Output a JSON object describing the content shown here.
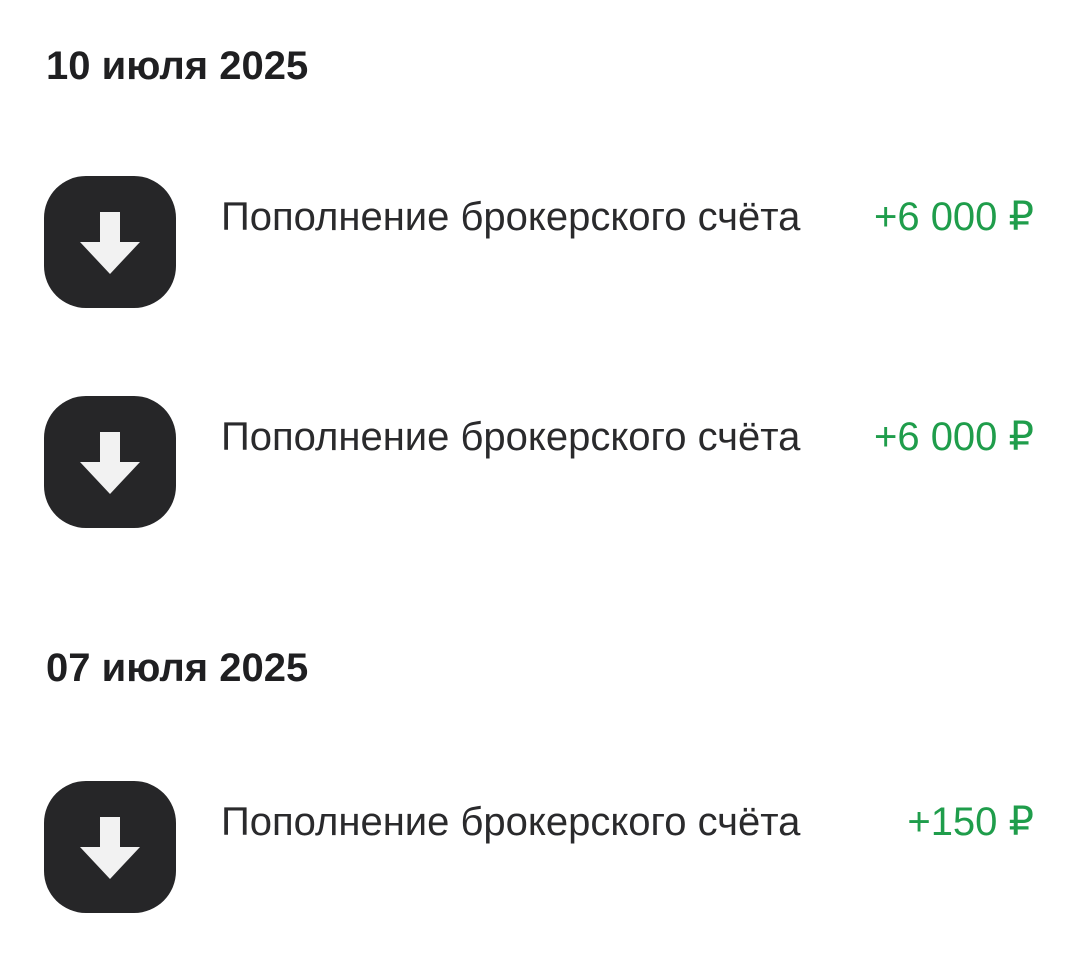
{
  "groups": [
    {
      "date": "10 июля 2025",
      "transactions": [
        {
          "icon": "arrow-down-icon",
          "title": "Пополнение брокерского счёта",
          "amount": "+6 000 ₽"
        },
        {
          "icon": "arrow-down-icon",
          "title": "Пополнение брокерского счёта",
          "amount": "+6 000 ₽"
        }
      ]
    },
    {
      "date": "07 июля 2025",
      "transactions": [
        {
          "icon": "arrow-down-icon",
          "title": "Пополнение брокерского счёта",
          "amount": "+150 ₽"
        }
      ]
    }
  ],
  "colors": {
    "income": "#1f9d4b",
    "icon_bg": "#262628",
    "icon_fg": "#f2f2f2",
    "text": "#1f1f21"
  }
}
